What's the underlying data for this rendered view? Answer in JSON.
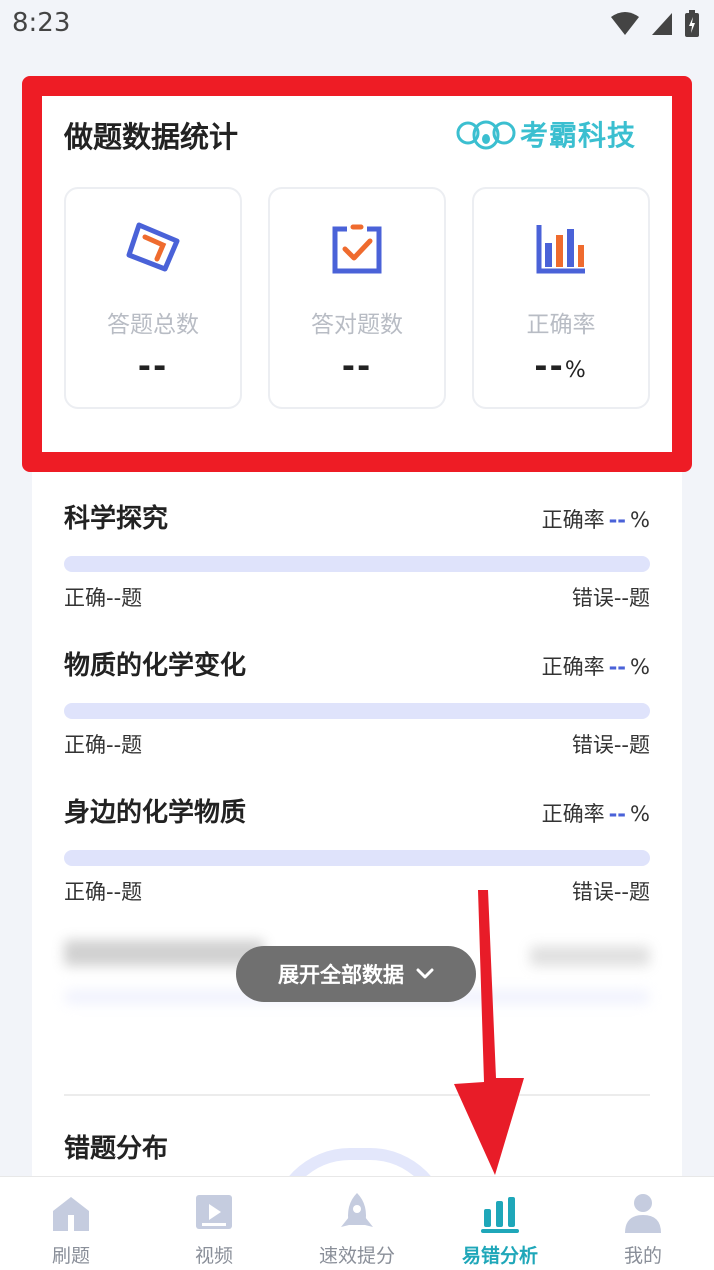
{
  "status_bar": {
    "time": "8:23"
  },
  "stats": {
    "title": "做题数据统计",
    "brand": "考霸科技",
    "items": [
      {
        "label": "答题总数",
        "value": "--",
        "suffix": "",
        "icon": "pencil-box-icon"
      },
      {
        "label": "答对题数",
        "value": "--",
        "suffix": "",
        "icon": "checked-box-icon"
      },
      {
        "label": "正确率",
        "value": "--",
        "suffix": "%",
        "icon": "bar-chart-icon"
      }
    ]
  },
  "topics": [
    {
      "name": "科学探究",
      "rate_label": "正确率",
      "rate_value": "--",
      "rate_unit": "%",
      "correct": "正确--题",
      "wrong": "错误--题"
    },
    {
      "name": "物质的化学变化",
      "rate_label": "正确率",
      "rate_value": "--",
      "rate_unit": "%",
      "correct": "正确--题",
      "wrong": "错误--题"
    },
    {
      "name": "身边的化学物质",
      "rate_label": "正确率",
      "rate_value": "--",
      "rate_unit": "%",
      "correct": "正确--题",
      "wrong": "错误--题"
    }
  ],
  "expand_button": {
    "label": "展开全部数据"
  },
  "distribution": {
    "title": "错题分布"
  },
  "tabbar": {
    "tabs": [
      {
        "label": "刷题",
        "icon": "home-icon"
      },
      {
        "label": "视频",
        "icon": "video-icon"
      },
      {
        "label": "速效提分",
        "icon": "rocket-icon"
      },
      {
        "label": "易错分析",
        "icon": "bar-chart-icon"
      },
      {
        "label": "我的",
        "icon": "person-icon"
      }
    ],
    "active_index": 3
  },
  "colors": {
    "highlight": "#ee1c25",
    "accent_blue": "#4a62d8",
    "accent_orange": "#ef6b2e",
    "brand_teal": "#3bbfd0",
    "active_tab": "#1fa7b9",
    "progress_track": "#dfe3fb"
  }
}
